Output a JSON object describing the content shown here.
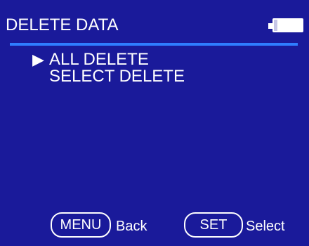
{
  "header": {
    "title": "DELETE DATA",
    "battery_icon": "battery-full-icon"
  },
  "menu": {
    "cursor_icon": "triangle-right-icon",
    "cursor_glyph": "▶",
    "items": [
      {
        "label": "ALL DELETE",
        "selected": true
      },
      {
        "label": "SELECT DELETE",
        "selected": false
      }
    ]
  },
  "footer": {
    "menu_key": "MENU",
    "menu_action": "Back",
    "set_key": "SET",
    "set_action": "Select"
  },
  "colors": {
    "background": "#1a1a9a",
    "divider": "#2f7dff",
    "text": "#ffffff"
  }
}
